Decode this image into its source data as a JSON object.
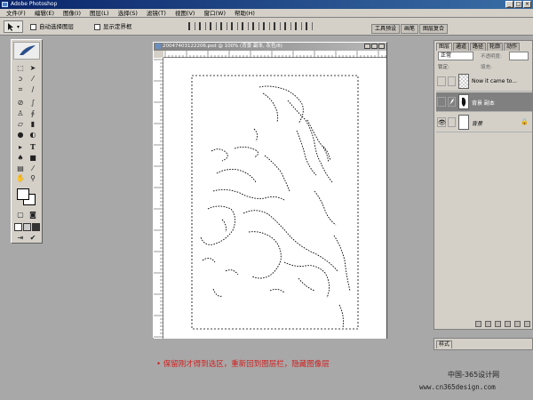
{
  "titlebar": {
    "title": "Adobe Photoshop",
    "minimize_glyph": "_",
    "maximize_glyph": "□",
    "close_glyph": "×"
  },
  "menu": [
    "文件(F)",
    "编辑(E)",
    "图像(I)",
    "图层(L)",
    "选择(S)",
    "滤镜(T)",
    "视图(V)",
    "窗口(W)",
    "帮助(H)"
  ],
  "options": {
    "auto_select_layer": "自动选择图层",
    "show_bounding_box": "显示定界框"
  },
  "palette_well": {
    "tabs": [
      "工具预设",
      "画笔",
      "图层复合"
    ]
  },
  "document": {
    "title": "20047403122206.psd @ 100% (背景 副本, 灰色/8)"
  },
  "layers_panel": {
    "tabs": [
      "图层",
      "通道",
      "路径",
      "轮廓",
      "动作"
    ],
    "blend_mode": "正常",
    "opacity_label": "不透明度:",
    "lock_label": "锁定:",
    "fill_label": "填充:",
    "layers": [
      {
        "name": "Now it came to...",
        "visible": false,
        "selected": false
      },
      {
        "name": "背景 副本",
        "visible": false,
        "selected": true
      },
      {
        "name": "背景",
        "visible": true,
        "selected": false
      }
    ],
    "eye_glyph": "👁",
    "lock_glyph": "🔒"
  },
  "styles_panel": {
    "tab": "样式"
  },
  "caption": "• 保留刚才得到选区，重新回到图层栏，隐藏图像层",
  "watermark": {
    "line1": "中国-365设计网",
    "line2": "www.cn365design.com"
  },
  "colors": {
    "caption_red": "#d02020",
    "titlebar_blue": "#0a246a",
    "workspace_gray": "#a8a8a8"
  }
}
